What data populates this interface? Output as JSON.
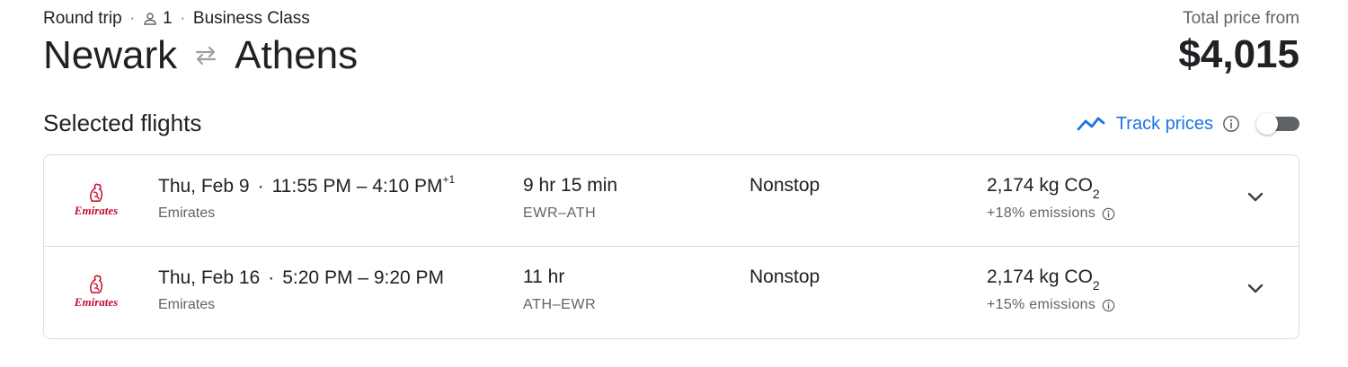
{
  "header": {
    "trip_type": "Round trip",
    "passengers": "1",
    "cabin_class": "Business Class",
    "origin": "Newark",
    "destination": "Athens",
    "price_label": "Total price from",
    "price": "$4,015"
  },
  "section": {
    "title": "Selected flights"
  },
  "track_prices": {
    "label": "Track prices",
    "enabled": false,
    "accent_color": "#1a73e8"
  },
  "flights": [
    {
      "airline": "Emirates",
      "logo_text": "Emirates",
      "date": "Thu, Feb 9",
      "depart": "11:55 PM",
      "arrive": "4:10 PM",
      "day_offset": "+1",
      "duration": "9 hr 15 min",
      "route": "EWR–ATH",
      "stops": "Nonstop",
      "co2": "2,174 kg CO",
      "co2_sub": "2",
      "emissions": "+18% emissions"
    },
    {
      "airline": "Emirates",
      "logo_text": "Emirates",
      "date": "Thu, Feb 16",
      "depart": "5:20 PM",
      "arrive": "9:20 PM",
      "day_offset": "",
      "duration": "11 hr",
      "route": "ATH–EWR",
      "stops": "Nonstop",
      "co2": "2,174 kg CO",
      "co2_sub": "2",
      "emissions": "+15% emissions"
    }
  ],
  "icons": {
    "person": "person-icon",
    "swap": "swap-arrows-icon",
    "chart": "price-trend-icon",
    "info": "info-icon",
    "expand": "chevron-down-icon",
    "logo": "emirates-logo"
  },
  "colors": {
    "brand_red": "#c60c30",
    "text_secondary": "#5f6368",
    "border": "#dadce0"
  }
}
